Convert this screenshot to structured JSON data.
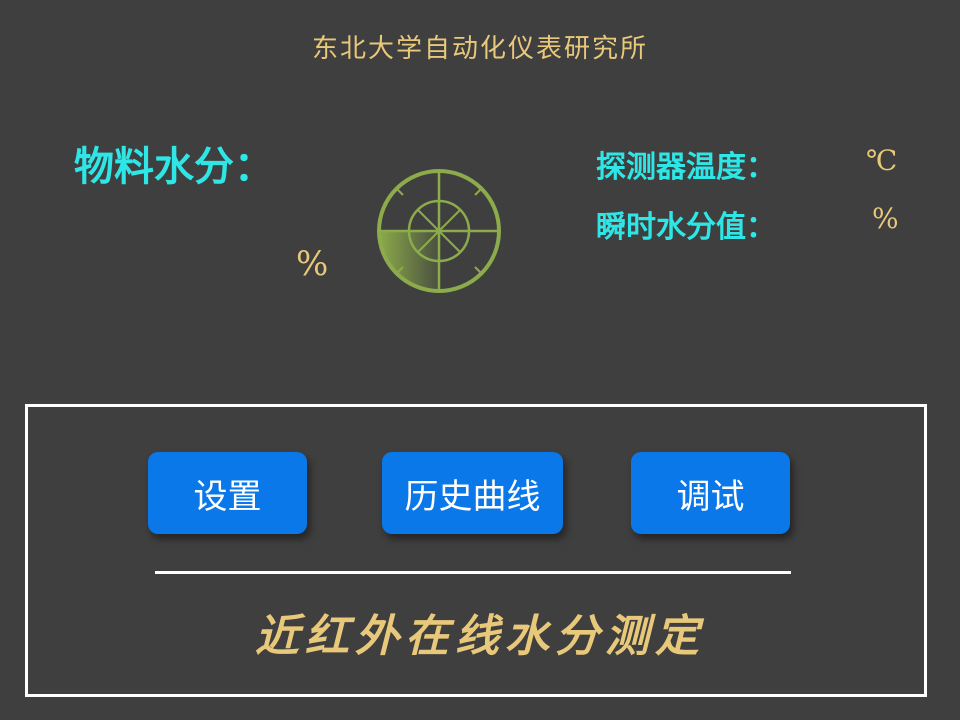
{
  "header": {
    "org_title": "东北大学自动化仪表研究所"
  },
  "main": {
    "moisture_label": "物料水分：",
    "moisture_unit": "%",
    "gauge_icon": "radar-dial-icon",
    "detector_temp_label": "探测器温度：",
    "detector_temp_unit": "℃",
    "instant_moisture_label": "瞬时水分值：",
    "instant_moisture_unit": "%"
  },
  "panel": {
    "buttons": [
      {
        "label": "设置"
      },
      {
        "label": "历史曲线"
      },
      {
        "label": "调试"
      }
    ],
    "footer_title": "近红外在线水分测定"
  },
  "colors": {
    "background": "#3f3f3f",
    "accent_cyan": "#2fe6e6",
    "accent_gold": "#e8c87a",
    "button_blue": "#0a78e8",
    "gauge_green": "#8cab4a"
  }
}
